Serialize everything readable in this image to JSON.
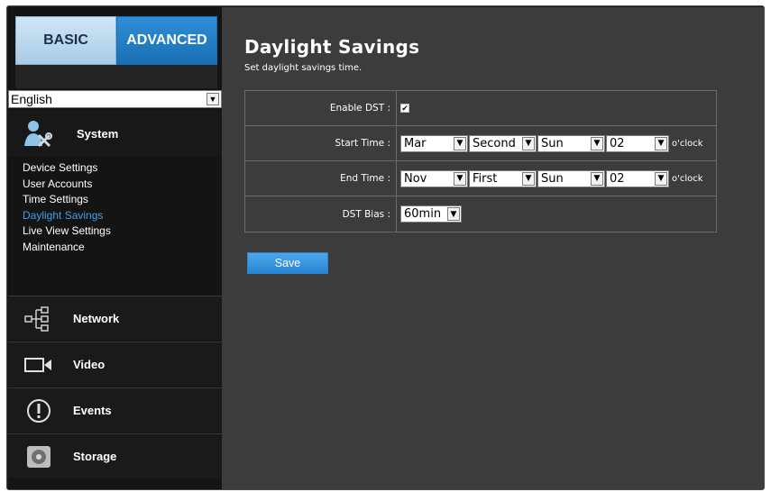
{
  "tabs": {
    "basic": "BASIC",
    "advanced": "ADVANCED"
  },
  "language": {
    "selected": "English"
  },
  "sidebar": {
    "system": {
      "label": "System",
      "icon": "system-tools-icon"
    },
    "submenu": [
      {
        "label": "Device Settings",
        "active": false
      },
      {
        "label": "User Accounts",
        "active": false
      },
      {
        "label": "Time Settings",
        "active": false
      },
      {
        "label": "Daylight Savings",
        "active": true
      },
      {
        "label": "Live View Settings",
        "active": false
      },
      {
        "label": "Maintenance",
        "active": false
      }
    ],
    "nav": [
      {
        "label": "Network",
        "icon": "network-tree-icon"
      },
      {
        "label": "Video",
        "icon": "video-camera-icon"
      },
      {
        "label": "Events",
        "icon": "alert-circle-icon"
      },
      {
        "label": "Storage",
        "icon": "hard-disk-icon"
      }
    ]
  },
  "page": {
    "title": "Daylight Savings",
    "subtitle": "Set daylight savings time."
  },
  "form": {
    "enable_dst": {
      "label": "Enable DST :",
      "checked": true
    },
    "start_time": {
      "label": "Start Time :",
      "month": "Mar",
      "week": "Second",
      "day": "Sun",
      "hour": "02",
      "suffix": "o'clock"
    },
    "end_time": {
      "label": "End Time :",
      "month": "Nov",
      "week": "First",
      "day": "Sun",
      "hour": "02",
      "suffix": "o'clock"
    },
    "dst_bias": {
      "label": "DST Bias :",
      "value": "60min"
    }
  },
  "actions": {
    "save_label": "Save"
  },
  "colors": {
    "accent": "#2a86d2",
    "active_link": "#3ea0e8",
    "panel": "#3c3c3c",
    "sidebar": "#141414"
  }
}
